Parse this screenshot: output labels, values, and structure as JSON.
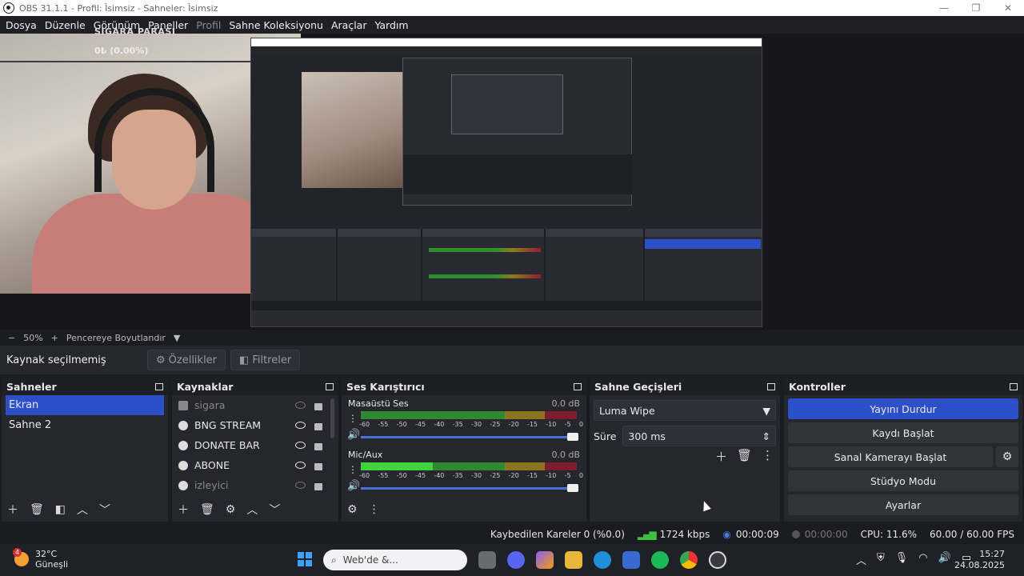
{
  "window": {
    "title": "OBS 31.1.1 - Profil: İsimsiz - Sahneler: İsimsiz"
  },
  "menu": [
    {
      "label": "Dosya",
      "enabled": true
    },
    {
      "label": "Düzenle",
      "enabled": true
    },
    {
      "label": "Görünüm",
      "enabled": true
    },
    {
      "label": "Paneller",
      "enabled": true
    },
    {
      "label": "Profil",
      "enabled": false
    },
    {
      "label": "Sahne Koleksiyonu",
      "enabled": true
    },
    {
      "label": "Araçlar",
      "enabled": true
    },
    {
      "label": "Yardım",
      "enabled": true
    }
  ],
  "preview": {
    "overlay_title": "SIGARA PARASI",
    "overlay_value": "0₺ (0.00%)"
  },
  "zoom": {
    "minus": "−",
    "percent": "50%",
    "plus": "+",
    "fit_label": "Pencereye Boyutlandır"
  },
  "source_bar": {
    "no_selection": "Kaynak seçilmemiş",
    "properties": "Özellikler",
    "filters": "Filtreler"
  },
  "scenes": {
    "title": "Sahneler",
    "items": [
      "Ekran",
      "Sahne 2"
    ],
    "active_index": 0
  },
  "sources": {
    "title": "Kaynaklar",
    "items": [
      {
        "label": "sigara",
        "type": "image",
        "visible": false
      },
      {
        "label": "BNG STREAM",
        "type": "browser",
        "visible": true
      },
      {
        "label": "DONATE BAR",
        "type": "browser",
        "visible": true
      },
      {
        "label": "ABONE",
        "type": "browser",
        "visible": true
      },
      {
        "label": "izleyici",
        "type": "browser",
        "visible": false
      }
    ]
  },
  "mixer": {
    "title": "Ses Karıştırıcı",
    "channels": [
      {
        "name": "Masaüstü Ses",
        "db": "0.0 dB"
      },
      {
        "name": "Mic/Aux",
        "db": "0.0 dB"
      }
    ],
    "ticks": [
      "-60",
      "-55",
      "-50",
      "-45",
      "-40",
      "-35",
      "-30",
      "-25",
      "-20",
      "-15",
      "-10",
      "-5",
      "0"
    ]
  },
  "transitions": {
    "title": "Sahne Geçişleri",
    "selected": "Luma Wipe",
    "duration_label": "Süre",
    "duration_value": "300 ms"
  },
  "controls": {
    "title": "Kontroller",
    "stop_stream": "Yayını Durdur",
    "start_record": "Kaydı Başlat",
    "virtual_cam": "Sanal Kamerayı Başlat",
    "studio_mode": "Stüdyo Modu",
    "settings": "Ayarlar"
  },
  "status": {
    "dropped_frames": "Kaybedilen Kareler 0 (%0.0)",
    "bitrate": "1724 kbps",
    "stream_time": "00:00:09",
    "record_time": "00:00:00",
    "cpu": "CPU: 11.6%",
    "fps": "60.00 / 60.00 FPS"
  },
  "taskbar": {
    "weather_temp": "32°C",
    "weather_desc": "Güneşli",
    "weather_badge": "4",
    "search_placeholder": "Web'de &...",
    "time": "15:27",
    "date": "24.08.2025"
  },
  "colors": {
    "accent": "#2d50c9",
    "meter_green": "#2f8a2f",
    "meter_yellow": "#8b7620",
    "meter_red": "#7d1e2c",
    "panel_bg": "#26262e"
  }
}
